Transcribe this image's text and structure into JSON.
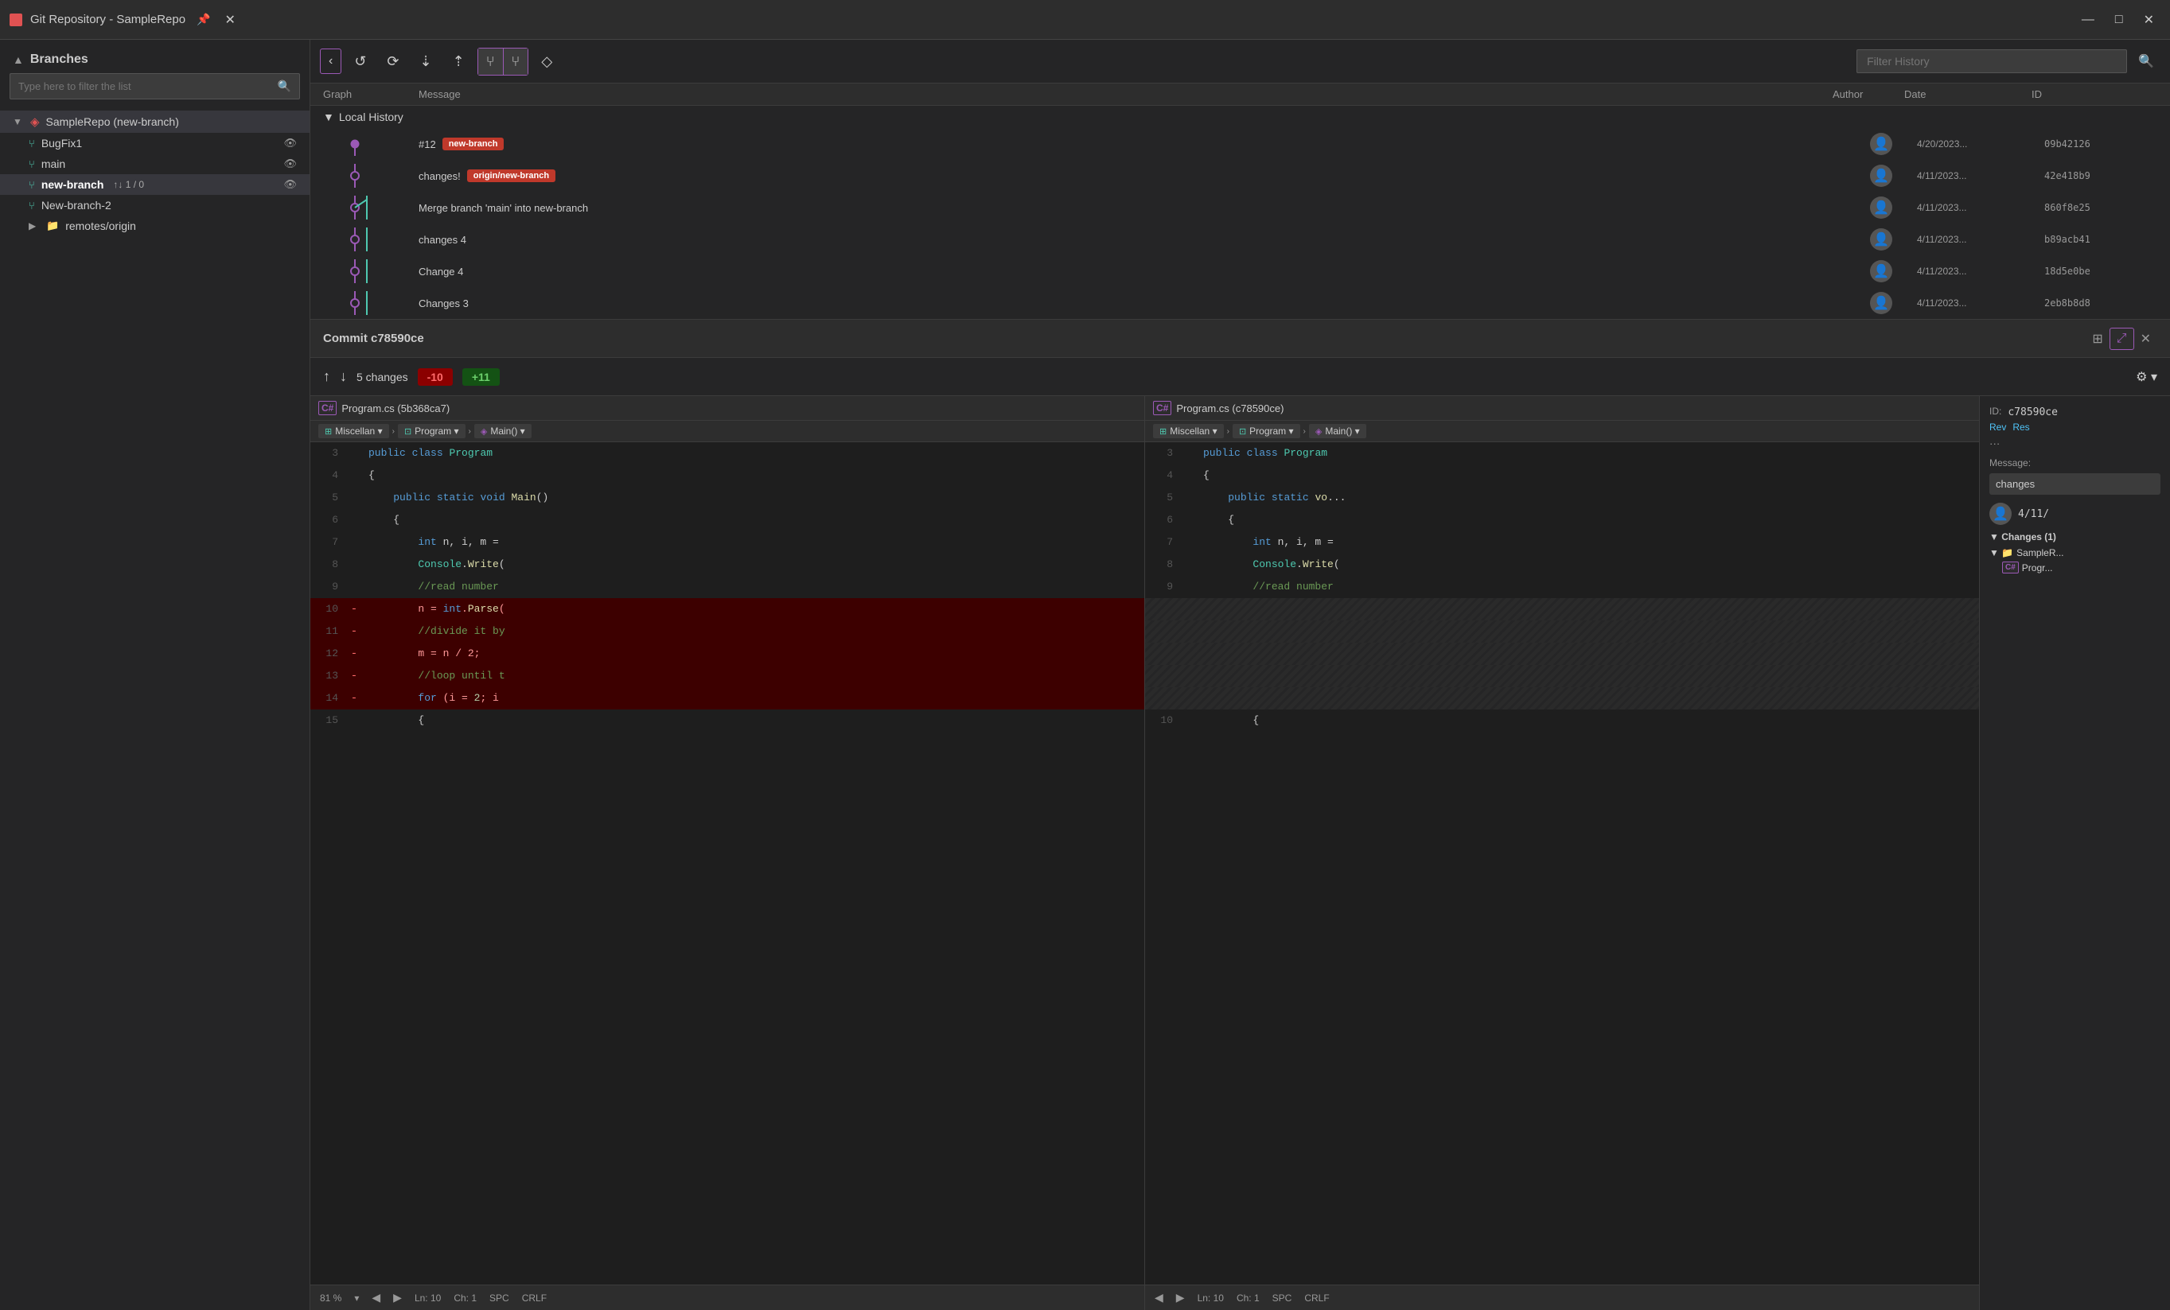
{
  "titleBar": {
    "title": "Git Repository - SampleRepo",
    "pin": "📌",
    "close": "✕",
    "winControls": [
      "—",
      "□",
      "✕"
    ]
  },
  "sidebar": {
    "header": "Branches",
    "searchPlaceholder": "Type here to filter the list",
    "tree": {
      "root": "SampleRepo (new-branch)",
      "branches": [
        {
          "name": "BugFix1",
          "icon": "branch",
          "color": "cyan"
        },
        {
          "name": "main",
          "icon": "branch",
          "color": "cyan"
        },
        {
          "name": "new-branch",
          "icon": "branch",
          "color": "cyan",
          "bold": true,
          "sync": "↑↓ 1 / 0"
        },
        {
          "name": "New-branch-2",
          "icon": "branch",
          "color": "cyan"
        }
      ],
      "remotes": "remotes/origin"
    }
  },
  "toolbar": {
    "refresh": "↺",
    "fetch": "⤓",
    "pull": "⤓",
    "push": "⤒",
    "branch": "⑂",
    "branchMerge": "⑂",
    "tag": "◇",
    "filterPlaceholder": "Filter History",
    "filterValue": ""
  },
  "historyPanel": {
    "columns": {
      "graph": "Graph",
      "message": "Message",
      "author": "Author",
      "date": "Date",
      "id": "ID"
    },
    "localHistory": "Local History",
    "commits": [
      {
        "message": "#12",
        "badges": [
          "new-branch"
        ],
        "date": "4/20/2023...",
        "id": "09b42126"
      },
      {
        "message": "changes!",
        "badges": [
          "origin/new-branch"
        ],
        "date": "4/11/2023...",
        "id": "42e418b9"
      },
      {
        "message": "Merge branch 'main' into new-branch",
        "badges": [],
        "date": "4/11/2023...",
        "id": "860f8e25"
      },
      {
        "message": "changes 4",
        "badges": [],
        "date": "4/11/2023...",
        "id": "b89acb41"
      },
      {
        "message": "Change 4",
        "badges": [],
        "date": "4/11/2023...",
        "id": "18d5e0be"
      },
      {
        "message": "Changes 3",
        "badges": [],
        "date": "4/11/2023...",
        "id": "2eb8b8d8"
      }
    ]
  },
  "diffArea": {
    "commitTitle": "Commit c78590ce",
    "changesCount": "5 changes",
    "deletions": "-10",
    "additions": "+11",
    "leftFile": "Program.cs (5b368ca7)",
    "rightFile": "Program.cs (c78590ce)",
    "breadcrumb": {
      "namespace": "Miscellan ▾",
      "class": "Program ▾",
      "method": "Main() ▾"
    },
    "zoomLeft": "81 %",
    "lnLeft": "Ln: 10",
    "chLeft": "Ch: 1",
    "encLeft": "SPC",
    "lineEndLeft": "CRLF",
    "lnRight": "Ln: 10",
    "chRight": "Ch: 1",
    "encRight": "SPC",
    "lineEndRight": "CRLF"
  },
  "commitDetails": {
    "idLabel": "ID:",
    "idValue": "c78590ce",
    "revLink": "Rev",
    "resLink": "Res",
    "messageLabel": "Message:",
    "messageValue": "changes",
    "dateValue": "4/11/",
    "changesLabel": "Changes (1)",
    "folderName": "SampleR...",
    "fileName": "Progr..."
  },
  "codeLines": {
    "left": [
      {
        "num": "3",
        "marker": "",
        "content": "    public class Program",
        "type": "normal"
      },
      {
        "num": "4",
        "marker": "",
        "content": "    {",
        "type": "normal"
      },
      {
        "num": "5",
        "marker": "",
        "content": "        public static void Main()",
        "type": "normal"
      },
      {
        "num": "6",
        "marker": "",
        "content": "        {",
        "type": "normal"
      },
      {
        "num": "7",
        "marker": "",
        "content": "            int n, i, m =",
        "type": "normal"
      },
      {
        "num": "8",
        "marker": "",
        "content": "            Console.Write(",
        "type": "normal"
      },
      {
        "num": "9",
        "marker": "",
        "content": "            //read number",
        "type": "normal"
      },
      {
        "num": "10",
        "marker": "-",
        "content": "            n = int.Parse(",
        "type": "removed"
      },
      {
        "num": "11",
        "marker": "-",
        "content": "            //divide it by",
        "type": "removed"
      },
      {
        "num": "12",
        "marker": "-",
        "content": "            m = n / 2;",
        "type": "removed"
      },
      {
        "num": "13",
        "marker": "-",
        "content": "            //loop until t",
        "type": "removed"
      },
      {
        "num": "14",
        "marker": "-",
        "content": "            for (i = 2; i",
        "type": "removed"
      },
      {
        "num": "15",
        "marker": "",
        "content": "            {",
        "type": "normal"
      }
    ],
    "right": [
      {
        "num": "3",
        "marker": "",
        "content": "    public class Program",
        "type": "normal"
      },
      {
        "num": "4",
        "marker": "",
        "content": "    {",
        "type": "normal"
      },
      {
        "num": "5",
        "marker": "",
        "content": "        public static void Main()",
        "type": "normal"
      },
      {
        "num": "6",
        "marker": "",
        "content": "        {",
        "type": "normal"
      },
      {
        "num": "7",
        "marker": "",
        "content": "            int n, i, m =",
        "type": "normal"
      },
      {
        "num": "8",
        "marker": "",
        "content": "            Console.Write(",
        "type": "normal"
      },
      {
        "num": "9",
        "marker": "",
        "content": "            //read number",
        "type": "normal"
      },
      {
        "num": "",
        "marker": "",
        "content": "",
        "type": "nodata"
      },
      {
        "num": "",
        "marker": "",
        "content": "",
        "type": "nodata"
      },
      {
        "num": "",
        "marker": "",
        "content": "",
        "type": "nodata"
      },
      {
        "num": "",
        "marker": "",
        "content": "",
        "type": "nodata"
      },
      {
        "num": "",
        "marker": "",
        "content": "",
        "type": "nodata"
      },
      {
        "num": "10",
        "marker": "",
        "content": "            {",
        "type": "normal"
      }
    ]
  }
}
